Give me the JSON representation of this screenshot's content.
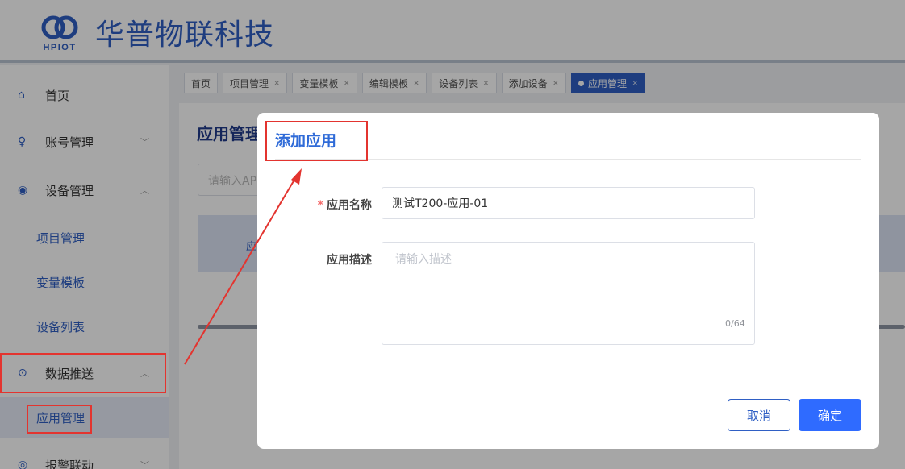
{
  "brand": {
    "logo_caption": "HPIOT",
    "name": "华普物联科技"
  },
  "sidebar": {
    "items": [
      {
        "label": "首页",
        "icon": "home-icon",
        "glyph": "⌂"
      },
      {
        "label": "账号管理",
        "icon": "user-icon",
        "glyph": "♀",
        "chevron": "﹀"
      },
      {
        "label": "设备管理",
        "icon": "device-icon",
        "glyph": "◉",
        "chevron": "︿"
      },
      {
        "label": "数据推送",
        "icon": "push-icon",
        "glyph": "⊙",
        "chevron": "︿"
      },
      {
        "label": "报警联动",
        "icon": "alarm-icon",
        "glyph": "◎",
        "chevron": "﹀"
      }
    ],
    "sub_items": [
      "项目管理",
      "变量模板",
      "设备列表",
      "应用管理"
    ]
  },
  "tabs": [
    {
      "label": "首页"
    },
    {
      "label": "项目管理",
      "close": "×"
    },
    {
      "label": "变量模板",
      "close": "×"
    },
    {
      "label": "编辑模板",
      "close": "×"
    },
    {
      "label": "设备列表",
      "close": "×"
    },
    {
      "label": "添加设备",
      "close": "×"
    },
    {
      "label": "应用管理",
      "close": "×",
      "active": true
    }
  ],
  "main": {
    "title": "应用管理",
    "search_placeholder": "请输入AP",
    "table_header_first": "应"
  },
  "dialog": {
    "title": "添加应用",
    "name_label": "应用名称",
    "required_mark": "*",
    "name_value": "测试T200-应用-01",
    "desc_label": "应用描述",
    "desc_placeholder": "请输入描述",
    "counter": "0/64",
    "cancel_label": "取消",
    "ok_label": "确定"
  },
  "colors": {
    "brand": "#2f5fc4",
    "primary": "#2f6bff",
    "highlight": "#e3342f"
  }
}
